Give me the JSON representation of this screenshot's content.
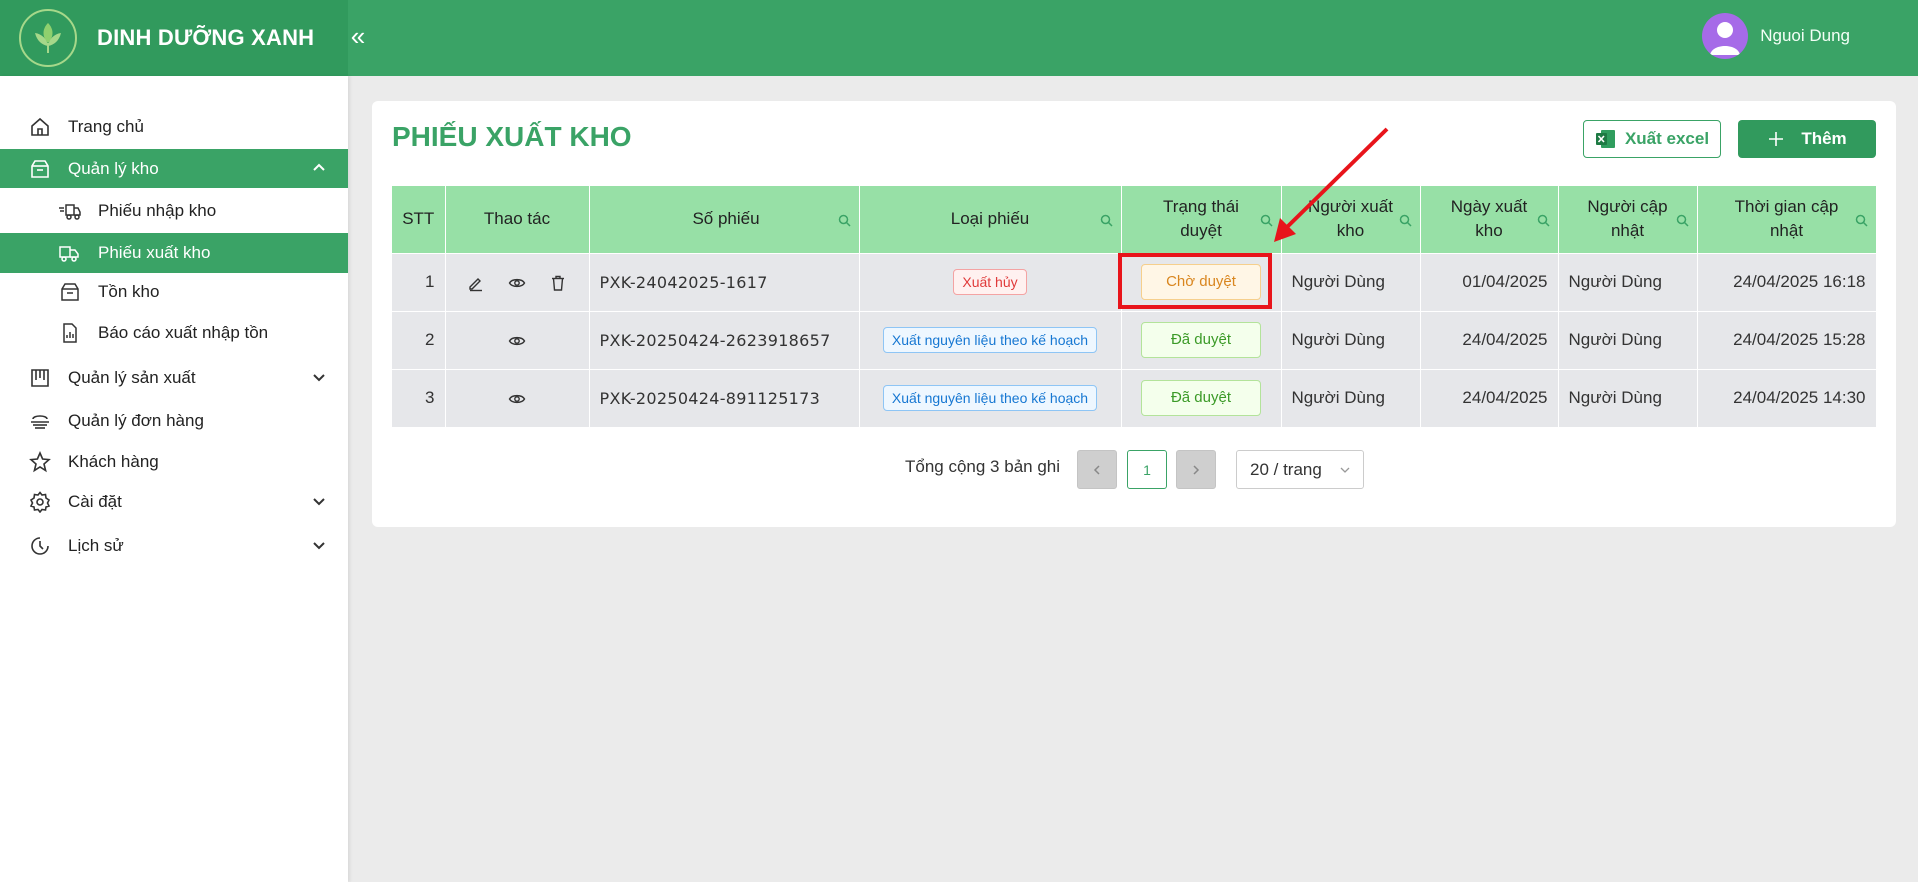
{
  "brand": {
    "name": "DINH DƯỠNG XANH"
  },
  "header": {
    "collapse_glyph": "«",
    "user_name": "Nguoi Dung"
  },
  "sidebar": {
    "items": [
      {
        "label": "Trang chủ",
        "icon": "home-icon"
      },
      {
        "label": "Quản lý kho",
        "icon": "warehouse-icon",
        "active": true,
        "expanded": true
      },
      {
        "label": "Phiếu nhập kho",
        "icon": "truck-in-icon"
      },
      {
        "label": "Phiếu xuất kho",
        "icon": "truck-out-icon",
        "active": true
      },
      {
        "label": "Tồn kho",
        "icon": "inventory-icon"
      },
      {
        "label": "Báo cáo xuất nhập tồn",
        "icon": "report-icon"
      },
      {
        "label": "Quản lý sản xuất",
        "icon": "factory-icon"
      },
      {
        "label": "Quản lý đơn hàng",
        "icon": "order-icon"
      },
      {
        "label": "Khách hàng",
        "icon": "star-icon"
      },
      {
        "label": "Cài đặt",
        "icon": "gear-icon"
      },
      {
        "label": "Lịch sử",
        "icon": "history-icon"
      }
    ]
  },
  "page": {
    "title": "PHIẾU XUẤT KHO",
    "export_label": "Xuất excel",
    "add_label": "Thêm"
  },
  "table": {
    "headers": {
      "stt": "STT",
      "action": "Thao tác",
      "so_phieu": "Số phiếu",
      "loai_phieu": "Loại phiếu",
      "trang_thai": "Trạng thái duyệt",
      "nguoi_xuat": "Người xuất kho",
      "ngay_xuat": "Ngày xuất kho",
      "nguoi_cap_nhat": "Người cập nhật",
      "thoi_gian": "Thời gian cập nhật"
    },
    "rows": [
      {
        "stt": "1",
        "so_phieu": "PXK-24042025-1617",
        "loai": "Xuất hủy",
        "trang_thai": "Chờ duyệt",
        "nguoi_xuat": "Người Dùng",
        "ngay_xuat": "01/04/2025",
        "nguoi_cap_nhat": "Người Dùng",
        "thoi_gian": "24/04/2025 16:18"
      },
      {
        "stt": "2",
        "so_phieu": "PXK-20250424-2623918657",
        "loai": "Xuất nguyên liệu theo kế hoạch",
        "trang_thai": "Đã duyệt",
        "nguoi_xuat": "Người Dùng",
        "ngay_xuat": "24/04/2025",
        "nguoi_cap_nhat": "Người Dùng",
        "thoi_gian": "24/04/2025 15:28"
      },
      {
        "stt": "3",
        "so_phieu": "PXK-20250424-891125173",
        "loai": "Xuất nguyên liệu theo kế hoạch",
        "trang_thai": "Đã duyệt",
        "nguoi_xuat": "Người Dùng",
        "ngay_xuat": "24/04/2025",
        "nguoi_cap_nhat": "Người Dùng",
        "thoi_gian": "24/04/2025 14:30"
      }
    ]
  },
  "pagination": {
    "total_text": "Tổng cộng 3 bản ghi",
    "current_page": "1",
    "page_size": "20 / trang"
  },
  "colors": {
    "primary": "#3aa366",
    "header_row": "#97e0a6",
    "highlight": "#e8141b"
  }
}
